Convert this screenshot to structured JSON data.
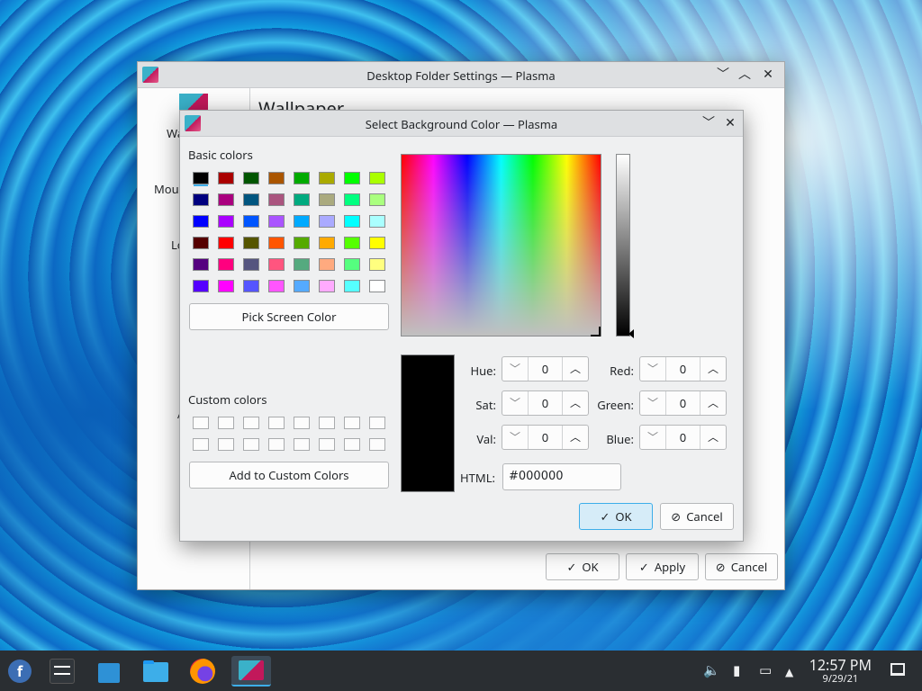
{
  "background_window": {
    "title": "Desktop Folder Settings — Plasma",
    "heading": "Wallpaper",
    "sidebar_items": [
      "Wa",
      "Mous",
      "Lo",
      "A"
    ],
    "buttons": {
      "ok": "OK",
      "apply": "Apply",
      "cancel": "Cancel"
    }
  },
  "dialog": {
    "title": "Select Background Color — Plasma",
    "basic_colors_label": "Basic colors",
    "basic_colors": [
      "#000000",
      "#aa0000",
      "#005500",
      "#aa5500",
      "#00aa00",
      "#aaaa00",
      "#00ff00",
      "#aaff00",
      "#00007f",
      "#aa007f",
      "#00557f",
      "#aa557f",
      "#00aa7f",
      "#aaaa7f",
      "#00ff7f",
      "#aaff7f",
      "#0000ff",
      "#aa00ff",
      "#0055ff",
      "#aa55ff",
      "#00aaff",
      "#aaaaff",
      "#00ffff",
      "#aaffff",
      "#550000",
      "#ff0000",
      "#555500",
      "#ff5500",
      "#55aa00",
      "#ffaa00",
      "#55ff00",
      "#ffff00",
      "#55007f",
      "#ff007f",
      "#55557f",
      "#ff557f",
      "#55aa7f",
      "#ffaa7f",
      "#55ff7f",
      "#ffff7f",
      "#5500ff",
      "#ff00ff",
      "#5555ff",
      "#ff55ff",
      "#55aaff",
      "#ffaaff",
      "#55ffff",
      "#ffffff"
    ],
    "pick_screen_color": "Pick Screen Color",
    "custom_colors_label": "Custom colors",
    "add_to_custom": "Add to Custom Colors",
    "fields": {
      "hue": {
        "label": "Hue:",
        "value": "0"
      },
      "sat": {
        "label": "Sat:",
        "value": "0"
      },
      "val": {
        "label": "Val:",
        "value": "0"
      },
      "red": {
        "label": "Red:",
        "value": "0"
      },
      "green": {
        "label": "Green:",
        "value": "0"
      },
      "blue": {
        "label": "Blue:",
        "value": "0"
      }
    },
    "html_label": "HTML:",
    "html_value": "#000000",
    "ok": "OK",
    "cancel": "Cancel"
  },
  "taskbar": {
    "time": "12:57 PM",
    "date": "9/29/21"
  },
  "colors": {
    "accent": "#3daee9",
    "window_bg": "#eff0f1",
    "taskbar_bg": "#2a2e32"
  }
}
